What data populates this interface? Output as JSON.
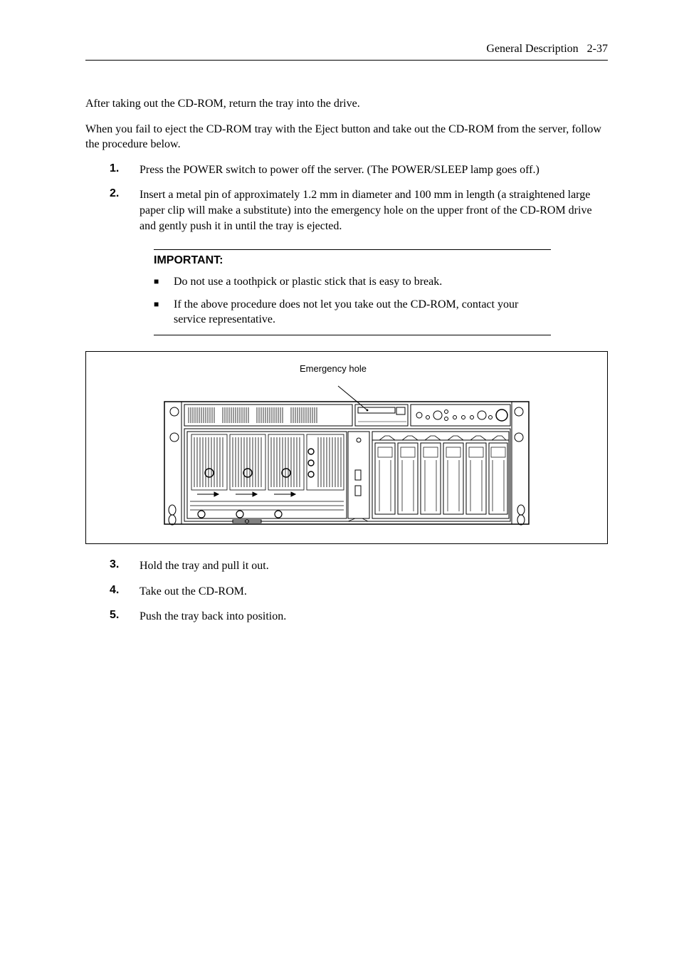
{
  "header": {
    "section": "General Description",
    "page": "2-37"
  },
  "paragraphs": {
    "p1": "After taking out the CD-ROM, return the tray into the drive.",
    "p2": "When you fail to eject the CD-ROM tray with the Eject button and take out the CD-ROM from the server, follow the procedure below."
  },
  "steps_top": [
    {
      "num": "1.",
      "text": "Press the POWER switch to power off the server.    (The POWER/SLEEP lamp goes off.)"
    },
    {
      "num": "2.",
      "text": "Insert a metal pin of approximately 1.2 mm in diameter and 100 mm in length (a straightened large paper clip will make a substitute) into the emergency hole on the upper front of the CD-ROM drive and gently push it in until the tray is ejected."
    }
  ],
  "important": {
    "title": "IMPORTANT:",
    "items": [
      "Do not use a toothpick or plastic stick that is easy to break.",
      "If the above procedure does not let you take out the CD-ROM, contact your service representative."
    ]
  },
  "figure": {
    "label": "Emergency hole"
  },
  "steps_bottom": [
    {
      "num": "3.",
      "text": "Hold the tray and pull it out."
    },
    {
      "num": "4.",
      "text": "Take out the CD-ROM."
    },
    {
      "num": "5.",
      "text": "Push the tray back into position."
    }
  ]
}
